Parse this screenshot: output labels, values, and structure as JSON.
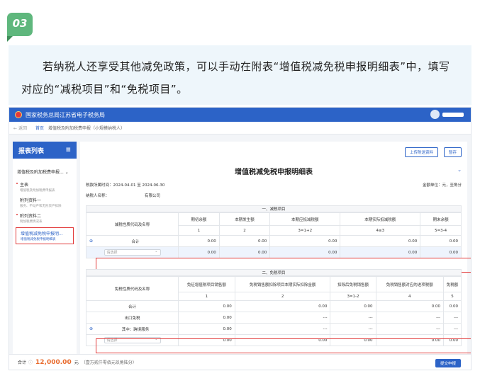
{
  "badge": "03",
  "intro": {
    "line": "若纳税人还享受其他减免政策，可以手动在附表“增值税减免税申报明细表”中，填写对应的“减税项目”和“免税项目”。"
  },
  "app": {
    "site_title": "国家税务总局江苏省电子税务局",
    "back": "返回",
    "home": "首页",
    "breadcrumb": "增值税及附加税费申报（小规模纳税人）"
  },
  "sidebar": {
    "title": "报表列表",
    "menu_icon": "≡",
    "group": "增值税及附加税费申报...",
    "items": [
      {
        "label": "主表",
        "sub": "增值税及附加税费申报表"
      },
      {
        "label": "附列资料一",
        "sub": "服务、不动产和无形资产扣除"
      },
      {
        "label": "附列资料二",
        "sub": "附加税费情况表"
      },
      {
        "label": "增值税减免税申报明...",
        "sub": "增值税减免税申报明细表"
      }
    ]
  },
  "main": {
    "upload_btn": "上传附送资料",
    "save_btn": "暂存",
    "form_title": "增值税减免税申报明细表",
    "period": "税款所属时间：2024-04-01 至 2024-06-30",
    "unit": "金额单位：元，至角分",
    "taxpayer_label": "纳税人名称：",
    "taxpayer_value": "有限公司",
    "reduction": {
      "section": "一、减税项目",
      "name_header": "减税性质代码及名称",
      "columns": [
        "期初余额",
        "本期发生额",
        "本期应抵减税额",
        "本期实际抵减税额",
        "期末余额"
      ],
      "col_nums": [
        "1",
        "2",
        "3=1+2",
        "4≤3",
        "5=3-4"
      ],
      "total_label": "合计",
      "total_values": [
        "0.00",
        "0.00",
        "0.00",
        "0.00",
        "0.00"
      ],
      "select_placeholder": "请选择",
      "row_values": [
        "0.00",
        "0.00",
        "0.00",
        "0.00",
        "0.00"
      ]
    },
    "exemption": {
      "section": "二、免税项目",
      "name_header": "免税性质代码及名称",
      "columns": [
        "免征增值税项目销售额",
        "免税销售额扣除项目本期实际扣除金额",
        "扣除后免税销售额",
        "免税销售额对应的进项税额",
        "免税额"
      ],
      "col_nums": [
        "1",
        "2",
        "3=1-2",
        "4",
        "5"
      ],
      "rows": [
        {
          "label": "合计",
          "values": [
            "0.00",
            "0.00",
            "0.00",
            "0.00",
            "0.00"
          ]
        },
        {
          "label": "出口免税",
          "values": [
            "0.00",
            "---",
            "---",
            "---",
            "---"
          ]
        },
        {
          "label": "其中：跨境服务",
          "values": [
            "0.00",
            "---",
            "---",
            "---",
            "---"
          ]
        }
      ],
      "select_placeholder": "请选择",
      "row_values": [
        "0.00",
        "0.00",
        "0.00",
        "0.00",
        "0.00"
      ]
    }
  },
  "footer": {
    "label": "合计",
    "amount": "12,000.00",
    "currency": "元",
    "note": "（壹万贰仟零佰元玖角陆分）",
    "submit": "提交申报"
  }
}
